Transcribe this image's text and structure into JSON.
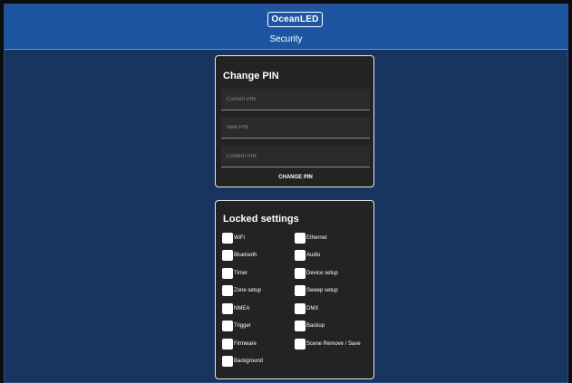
{
  "header": {
    "logo_text": "OceanLED",
    "title": "Security"
  },
  "change_pin": {
    "title": "Change PIN",
    "current_pin_placeholder": "Current PIN",
    "new_pin_placeholder": "New PIN",
    "confirm_pin_placeholder": "Confirm PIN",
    "button_label": "CHANGE PIN"
  },
  "locked_settings": {
    "title": "Locked settings",
    "items": [
      {
        "label": "WiFi",
        "checked": false
      },
      {
        "label": "Ethernet",
        "checked": false
      },
      {
        "label": "Bluetooth",
        "checked": false
      },
      {
        "label": "Audio",
        "checked": false
      },
      {
        "label": "Timer",
        "checked": false
      },
      {
        "label": "Device setup",
        "checked": false
      },
      {
        "label": "Zone setup",
        "checked": false
      },
      {
        "label": "Sweep setup",
        "checked": false
      },
      {
        "label": "NMEA",
        "checked": false
      },
      {
        "label": "DMX",
        "checked": false
      },
      {
        "label": "Trigger",
        "checked": false
      },
      {
        "label": "Backup",
        "checked": false
      },
      {
        "label": "Firmware",
        "checked": false
      },
      {
        "label": "Scene Remove / Save",
        "checked": false
      },
      {
        "label": "Background",
        "checked": false
      }
    ]
  },
  "colors": {
    "header_bg": "#1d55a3",
    "page_bg": "#17355f",
    "card_bg": "#232323"
  }
}
